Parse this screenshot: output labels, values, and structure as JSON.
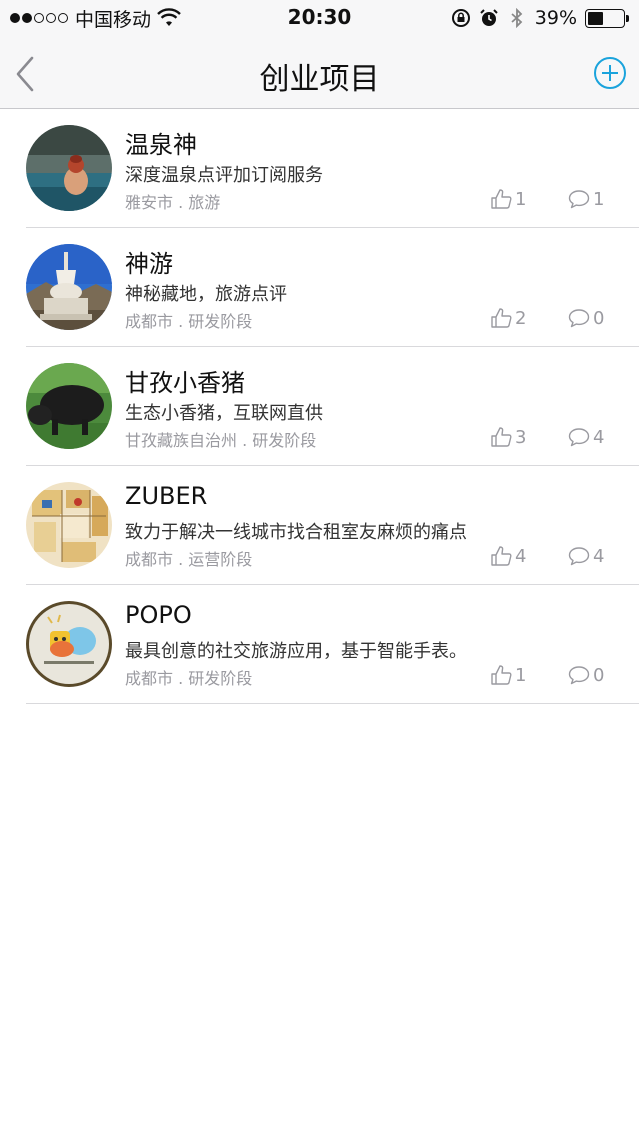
{
  "status_bar": {
    "carrier": "中国移动",
    "time": "20:30",
    "battery_percent": "39%",
    "battery_level": 0.39,
    "icons": [
      "signal-dots-icon",
      "wifi-icon",
      "rotation-lock-icon",
      "alarm-icon",
      "bluetooth-icon",
      "battery-icon"
    ]
  },
  "nav": {
    "title": "创业项目",
    "back_icon": "chevron-left-icon",
    "add_icon": "plus-circle-icon",
    "accent_color": "#1aa3dc"
  },
  "projects": [
    {
      "name": "温泉神",
      "description": "深度温泉点评加订阅服务",
      "meta": "雅安市 . 旅游",
      "likes": "1",
      "comments": "1",
      "avatar_icon": "hot-spring-photo"
    },
    {
      "name": "神游",
      "description": "神秘藏地，旅游点评",
      "meta": "成都市 . 研发阶段",
      "likes": "2",
      "comments": "0",
      "avatar_icon": "stupa-photo"
    },
    {
      "name": "甘孜小香猪",
      "description": "生态小香猪，互联网直供",
      "meta": "甘孜藏族自治州 . 研发阶段",
      "likes": "3",
      "comments": "4",
      "avatar_icon": "pig-photo"
    },
    {
      "name": "ZUBER",
      "description": "致力于解决一线城市找合租室友麻烦的痛点",
      "meta": "成都市 . 运营阶段",
      "likes": "4",
      "comments": "4",
      "avatar_icon": "floorplan-logo"
    },
    {
      "name": "POPO",
      "description": "最具创意的社交旅游应用，基于智能手表。",
      "meta": "成都市 . 研发阶段",
      "likes": "1",
      "comments": "0",
      "avatar_icon": "popo-logo"
    }
  ]
}
